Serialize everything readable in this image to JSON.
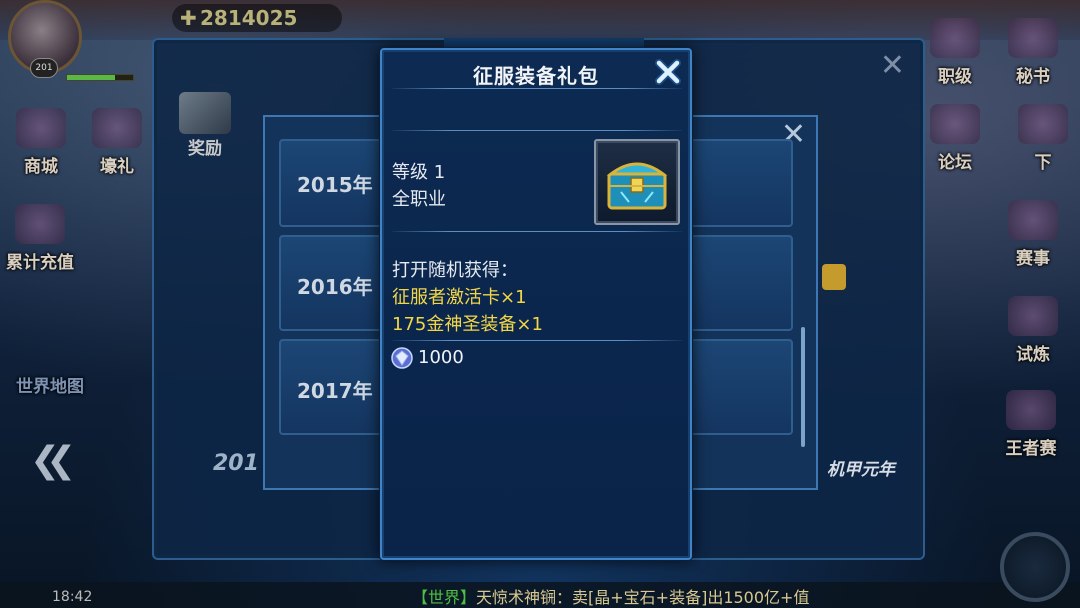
{
  "hud": {
    "avatar_level": "201",
    "hp_fraction": 0.72,
    "currency_value": "2814025",
    "buttons": {
      "shop": "商城",
      "gift": "壕礼",
      "recharge": "累计充值",
      "world_map": "世界地图",
      "rank": "职级",
      "secretary": "秘书",
      "forum": "论坛",
      "down": "下",
      "event": "赛事",
      "trial": "试炼",
      "king": "王者赛"
    },
    "time": "18:42",
    "chat": {
      "channel": "【世界】",
      "message": "天惊术神锎：卖[晶+宝石+装备]出1500亿+值"
    }
  },
  "back_panel": {
    "tab_reward": "奖励",
    "left_year": "201",
    "era_label": "机甲元年"
  },
  "mid_panel": {
    "years": [
      "2015年",
      "2016年",
      "2017年"
    ]
  },
  "modal": {
    "title": "征服装备礼包",
    "level": "等级 1",
    "class": "全职业",
    "reward_heading": "打开随机获得：",
    "rewards": [
      "征服者激活卡×1",
      "175金神圣装备×1"
    ],
    "price": "1000",
    "colors": {
      "accent_border": "#3f83c8",
      "reward_text": "#f3d648"
    }
  }
}
